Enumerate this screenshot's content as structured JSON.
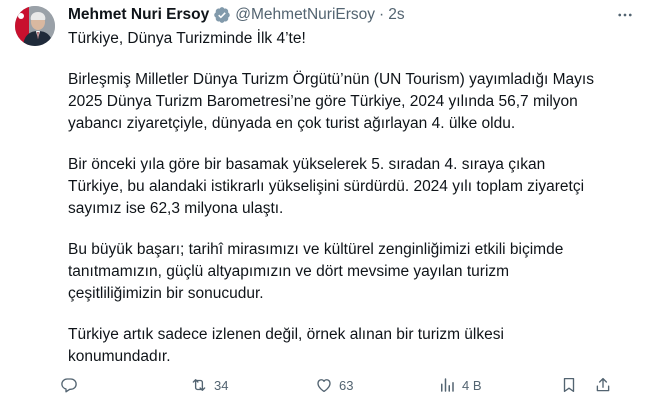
{
  "author": {
    "name": "Mehmet Nuri Ersoy",
    "handle": "@MehmetNuriErsoy",
    "separator": "·",
    "time": "2s"
  },
  "tweet": {
    "title": "Türkiye, Dünya Turizminde İlk 4’te!",
    "paragraphs": [
      [
        "Birleşmiş Milletler Dünya Turizm Örgütü’nün (UN Tourism) yayımladığı Mayıs",
        "2025 Dünya Turizm Barometresi’ne göre Türkiye, 2024 yılında 56,7 milyon",
        "yabancı ziyaretçiyle, dünyada en çok turist ağırlayan 4. ülke oldu."
      ],
      [
        "Bir önceki yıla göre bir basamak yükselerek 5. sıradan 4. sıraya çıkan",
        "Türkiye, bu alandaki istikrarlı yükselişini sürdürdü. 2024 yılı toplam ziyaretçi",
        "sayımız ise 62,3 milyona ulaştı."
      ],
      [
        "Bu büyük başarı; tarihî mirasımızı ve kültürel zenginliğimizi etkili biçimde",
        "tanıtmamızın, güçlü altyapımızın ve dört mevsime yayılan turizm",
        "çeşitliliğimizin bir sonucudur."
      ],
      [
        "Türkiye artık sadece izlenen değil, örnek alınan bir turizm ülkesi",
        "konumundadır."
      ]
    ]
  },
  "actions": {
    "reply_count": "",
    "retweet_count": "34",
    "like_count": "63",
    "views_count": "4 B"
  },
  "colors": {
    "text": "#0f1419",
    "muted": "#536471",
    "verified": "#829aab"
  },
  "icons": [
    "verified-badge-icon",
    "more-icon",
    "reply-icon",
    "retweet-icon",
    "like-icon",
    "views-icon",
    "bookmark-icon",
    "share-icon"
  ]
}
